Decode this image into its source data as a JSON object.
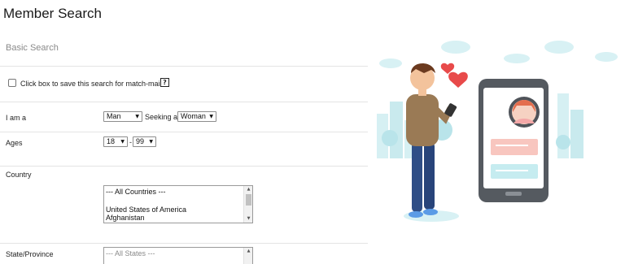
{
  "page": {
    "title": "Member Search",
    "section_title": "Basic Search"
  },
  "save_search": {
    "label": "Click box to save this search for match-mail",
    "checked": false,
    "help_icon_text": "?"
  },
  "gender": {
    "label": "I am a",
    "self_value": "Man",
    "seeking_text": "Seeking a",
    "seeking_value": "Woman"
  },
  "ages": {
    "label": "Ages",
    "min_value": "18",
    "separator": "-",
    "max_value": "99"
  },
  "country": {
    "label": "Country",
    "options": [
      "--- All Countries ---",
      "",
      "United States of America",
      "Afghanistan"
    ]
  },
  "state": {
    "label": "State/Province",
    "placeholder_option": "--- All States ---"
  },
  "colors": {
    "accent_pink": "#f4a8a8",
    "heart_red": "#e84a4a",
    "light_blue": "#c6ecf0",
    "phone_dark": "#555a60"
  }
}
